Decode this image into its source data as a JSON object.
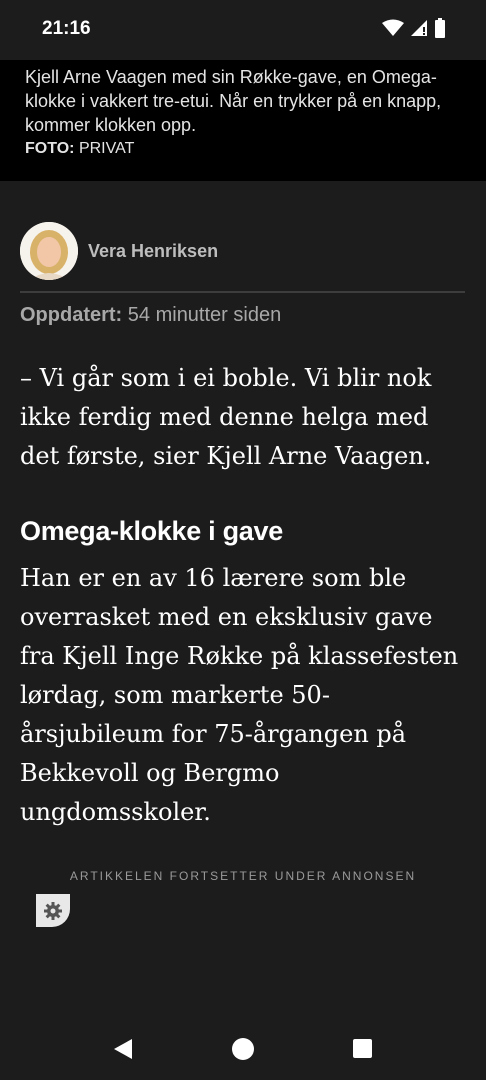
{
  "status_bar": {
    "time": "21:16"
  },
  "caption": {
    "text": "Kjell Arne Vaagen med sin Røkke-gave, en Omega-klokke i vakkert tre-etui. Når en trykker på en knapp, kommer klokken opp.",
    "credit_label": "FOTO:",
    "credit_value": "PRIVAT"
  },
  "author": {
    "name": "Vera Henriksen"
  },
  "updated": {
    "label": "Oppdatert:",
    "value": "54 minutter siden"
  },
  "article": {
    "paragraph1": "– Vi går som i ei boble. Vi blir nok ikke ferdig med denne helga med det første, sier Kjell Arne Vaagen.",
    "heading": "Omega-klokke i gave",
    "paragraph2": "Han er en av 16 lærere som ble overrasket med en eksklusiv gave fra Kjell Inge Røkke på klassefesten lørdag, som markerte 50-årsjubileum for 75-årgangen på Bekkevoll og Bergmo ungdomsskoler."
  },
  "ad": {
    "notice": "ARTIKKELEN FORTSETTER UNDER ANNONSEN"
  },
  "icons": {
    "wifi": "wifi-icon",
    "signal": "signal-icon",
    "battery": "battery-icon",
    "gear": "gear-icon",
    "back": "back-icon",
    "home": "home-icon",
    "recents": "recents-icon"
  }
}
